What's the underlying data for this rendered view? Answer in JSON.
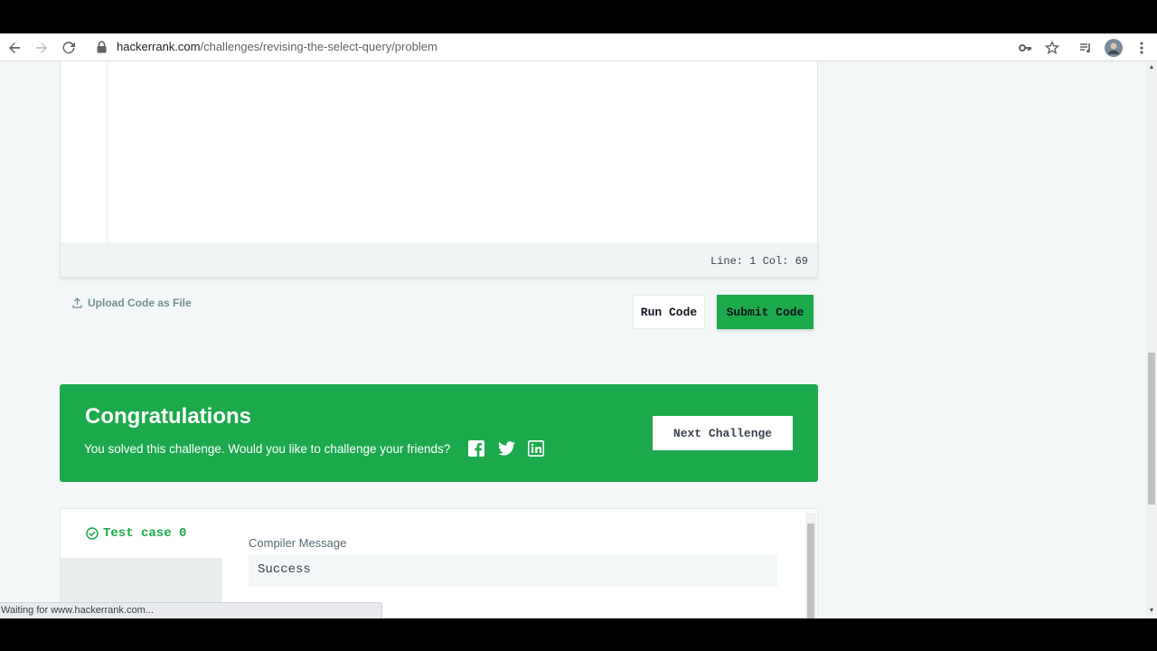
{
  "browser": {
    "url_domain": "hackerrank.com",
    "url_path": "/challenges/revising-the-select-query/problem",
    "status_text": "Waiting for www.hackerrank.com..."
  },
  "editor": {
    "cursor_position": "Line: 1 Col: 69"
  },
  "actions": {
    "upload_label": "Upload Code as File",
    "run_label": "Run Code",
    "submit_label": "Submit Code"
  },
  "congrats": {
    "title": "Congratulations",
    "subtitle": "You solved this challenge. Would you like to challenge your friends?",
    "next_label": "Next Challenge"
  },
  "results": {
    "testcase_label": "Test case 0",
    "compiler_label": "Compiler Message",
    "compiler_value": "Success"
  },
  "colors": {
    "accent_green": "#1ba94c",
    "page_bg": "#f3f7f7"
  }
}
